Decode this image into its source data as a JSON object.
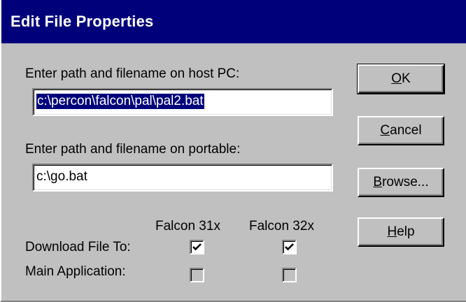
{
  "window": {
    "title": "Edit File Properties"
  },
  "host_path": {
    "label": "Enter path and filename on host PC:",
    "value": "c:\\percon\\falcon\\pal\\pal2.bat",
    "selected": true
  },
  "portable_path": {
    "label": "Enter path and filename on portable:",
    "value": "c:\\go.bat"
  },
  "buttons": {
    "ok": {
      "mnemonic": "O",
      "rest": "K"
    },
    "cancel": {
      "mnemonic": "C",
      "rest": "ancel"
    },
    "browse": {
      "mnemonic": "B",
      "rest": "rowse..."
    },
    "help": {
      "mnemonic": "H",
      "rest": "elp"
    }
  },
  "options": {
    "columns": [
      "Falcon 31x",
      "Falcon 32x"
    ],
    "rows": [
      {
        "label": "Download File To:",
        "falcon31x": true,
        "falcon32x": true,
        "enabled": true
      },
      {
        "label": "Main Application:",
        "falcon31x": false,
        "falcon32x": false,
        "enabled": false
      }
    ]
  },
  "colors": {
    "titlebar": "#00007b",
    "face": "#c0c0c0",
    "selection": "#00007b"
  }
}
